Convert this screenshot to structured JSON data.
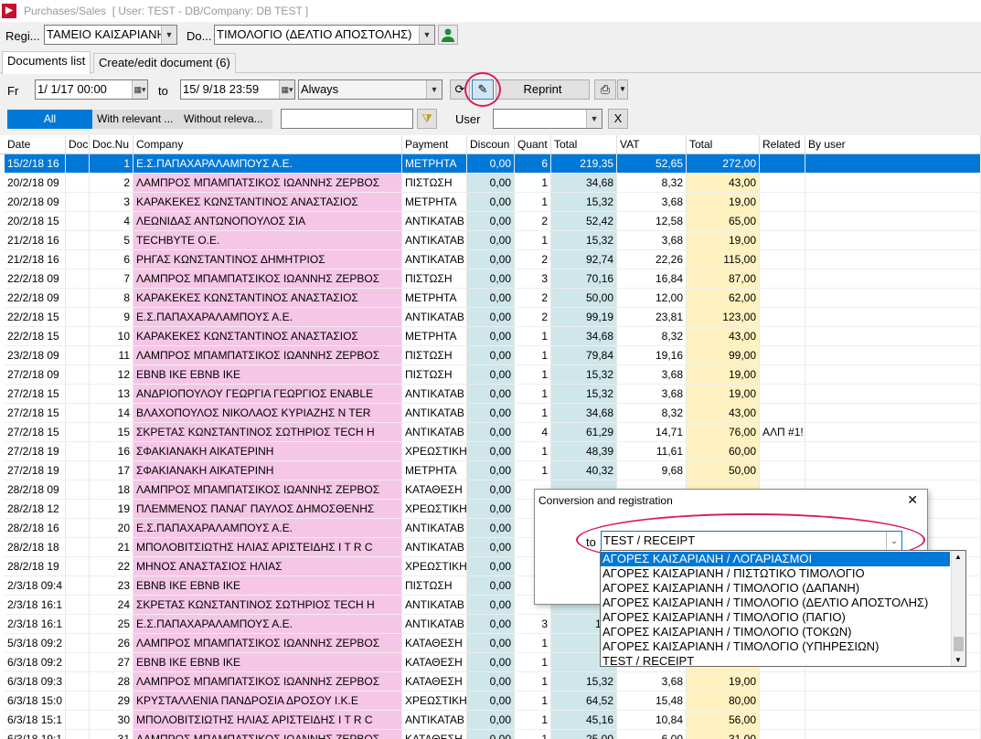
{
  "window": {
    "title": "Purchases/Sales",
    "context": "[ User: TEST - DB/Company: DB TEST ]"
  },
  "filters": {
    "register_label": "Regi...",
    "register_value": "ΤΑΜΕΙΟ ΚΑΙΣΑΡΙΑΝΗ",
    "doc_label": "Do...",
    "doc_value": "ΤΙΜΟΛΟΓΙΟ (ΔΕΛΤΙΟ ΑΠΟΣΤΟΛΗΣ)",
    "from_label": "Fr",
    "from_value": "1/ 1/17 00:00",
    "to_label": "to",
    "to_value": "15/ 9/18 23:59",
    "period_value": "Always",
    "reprint_label": "Reprint",
    "seg_all": "All",
    "seg_relevant": "With relevant ...",
    "seg_without": "Without releva...",
    "user_label": "User",
    "user_value": "",
    "search_value": "",
    "clear_label": "X"
  },
  "tabs": [
    {
      "label": "Documents list"
    },
    {
      "label": "Create/edit document (6)"
    }
  ],
  "grid": {
    "columns": [
      "Date",
      "Doc",
      "Doc.Nu",
      "Company",
      "Payment",
      "Discoun",
      "Quant",
      "Total",
      "VAT",
      "Total",
      "Related",
      "By user"
    ],
    "rows": [
      {
        "date": "15/2/18 16",
        "num": "1",
        "company": "Ε.Σ.ΠΑΠΑΧΑΡΑΛΑΜΠΟΥΣ Α.Ε.",
        "payment": "ΜΕΤΡΗΤΑ",
        "disc": "0,00",
        "qty": "6",
        "total": "219,35",
        "vat": "52,65",
        "gross": "272,00",
        "related": ""
      },
      {
        "date": "20/2/18 09",
        "num": "2",
        "company": "ΛΑΜΠΡΟΣ ΜΠΑΜΠΑΤΣΙΚΟΣ ΙΩΑΝΝΗΣ ΖΕΡΒΟΣ",
        "payment": "ΠΙΣΤΩΣΗ",
        "disc": "0,00",
        "qty": "1",
        "total": "34,68",
        "vat": "8,32",
        "gross": "43,00",
        "related": ""
      },
      {
        "date": "20/2/18 09",
        "num": "3",
        "company": "ΚΑΡΑΚΕΚΕΣ ΚΩΝΣΤΑΝΤΙΝΟΣ ΑΝΑΣΤΑΣΙΟΣ",
        "payment": "ΜΕΤΡΗΤΑ",
        "disc": "0,00",
        "qty": "1",
        "total": "15,32",
        "vat": "3,68",
        "gross": "19,00",
        "related": ""
      },
      {
        "date": "20/2/18 15",
        "num": "4",
        "company": "ΛΕΩΝΙΔΑΣ ΑΝΤΩΝΟΠΟΥΛΟΣ ΣΙΑ",
        "payment": "ΑΝΤΙΚΑΤΑΒ",
        "disc": "0,00",
        "qty": "2",
        "total": "52,42",
        "vat": "12,58",
        "gross": "65,00",
        "related": ""
      },
      {
        "date": "21/2/18 16",
        "num": "5",
        "company": "TECHBYTE Ο.Ε.",
        "payment": "ΑΝΤΙΚΑΤΑΒ",
        "disc": "0,00",
        "qty": "1",
        "total": "15,32",
        "vat": "3,68",
        "gross": "19,00",
        "related": ""
      },
      {
        "date": "21/2/18 16",
        "num": "6",
        "company": "ΡΗΓΑΣ ΚΩΝΣΤΑΝΤΙΝΟΣ ΔΗΜΗΤΡΙΟΣ",
        "payment": "ΑΝΤΙΚΑΤΑΒ",
        "disc": "0,00",
        "qty": "2",
        "total": "92,74",
        "vat": "22,26",
        "gross": "115,00",
        "related": ""
      },
      {
        "date": "22/2/18 09",
        "num": "7",
        "company": "ΛΑΜΠΡΟΣ ΜΠΑΜΠΑΤΣΙΚΟΣ ΙΩΑΝΝΗΣ ΖΕΡΒΟΣ",
        "payment": "ΠΙΣΤΩΣΗ",
        "disc": "0,00",
        "qty": "3",
        "total": "70,16",
        "vat": "16,84",
        "gross": "87,00",
        "related": ""
      },
      {
        "date": "22/2/18 09",
        "num": "8",
        "company": "ΚΑΡΑΚΕΚΕΣ ΚΩΝΣΤΑΝΤΙΝΟΣ ΑΝΑΣΤΑΣΙΟΣ",
        "payment": "ΜΕΤΡΗΤΑ",
        "disc": "0,00",
        "qty": "2",
        "total": "50,00",
        "vat": "12,00",
        "gross": "62,00",
        "related": ""
      },
      {
        "date": "22/2/18 15",
        "num": "9",
        "company": "Ε.Σ.ΠΑΠΑΧΑΡΑΛΑΜΠΟΥΣ Α.Ε.",
        "payment": "ΑΝΤΙΚΑΤΑΒ",
        "disc": "0,00",
        "qty": "2",
        "total": "99,19",
        "vat": "23,81",
        "gross": "123,00",
        "related": ""
      },
      {
        "date": "22/2/18 15",
        "num": "10",
        "company": "ΚΑΡΑΚΕΚΕΣ ΚΩΝΣΤΑΝΤΙΝΟΣ ΑΝΑΣΤΑΣΙΟΣ",
        "payment": "ΜΕΤΡΗΤΑ",
        "disc": "0,00",
        "qty": "1",
        "total": "34,68",
        "vat": "8,32",
        "gross": "43,00",
        "related": ""
      },
      {
        "date": "23/2/18 09",
        "num": "11",
        "company": "ΛΑΜΠΡΟΣ ΜΠΑΜΠΑΤΣΙΚΟΣ ΙΩΑΝΝΗΣ ΖΕΡΒΟΣ",
        "payment": "ΠΙΣΤΩΣΗ",
        "disc": "0,00",
        "qty": "1",
        "total": "79,84",
        "vat": "19,16",
        "gross": "99,00",
        "related": ""
      },
      {
        "date": "27/2/18 09",
        "num": "12",
        "company": "ΕΒΝΒ ΙΚΕ   ΕΒΝΒ ΙΚΕ",
        "payment": "ΠΙΣΤΩΣΗ",
        "disc": "0,00",
        "qty": "1",
        "total": "15,32",
        "vat": "3,68",
        "gross": "19,00",
        "related": ""
      },
      {
        "date": "27/2/18 15",
        "num": "13",
        "company": "ΑΝΔΡΙΟΠΟΥΛΟΥ ΓΕΩΡΓΙΑ ΓΕΩΡΓΙΟΣ  ENABLE",
        "payment": "ΑΝΤΙΚΑΤΑΒ",
        "disc": "0,00",
        "qty": "1",
        "total": "15,32",
        "vat": "3,68",
        "gross": "19,00",
        "related": ""
      },
      {
        "date": "27/2/18 15",
        "num": "14",
        "company": "ΒΛΑΧΟΠΟΥΛΟΣ ΝΙΚΟΛΑΟΣ ΚΥΡΙΑΖΗΣ   N TER",
        "payment": "ΑΝΤΙΚΑΤΑΒ",
        "disc": "0,00",
        "qty": "1",
        "total": "34,68",
        "vat": "8,32",
        "gross": "43,00",
        "related": ""
      },
      {
        "date": "27/2/18 15",
        "num": "15",
        "company": "ΣΚΡΕΤΑΣ ΚΩΝΣΤΑΝΤΙΝΟΣ ΣΩΤΗΡΙΟΣ   TECH H",
        "payment": "ΑΝΤΙΚΑΤΑΒ",
        "disc": "0,00",
        "qty": "4",
        "total": "61,29",
        "vat": "14,71",
        "gross": "76,00",
        "related": "ΑΛΠ #1!"
      },
      {
        "date": "27/2/18 19",
        "num": "16",
        "company": "ΣΦΑΚΙΑΝΑΚΗ ΑΙΚΑΤΕΡΙΝΗ",
        "payment": "ΧΡΕΩΣΤΙΚΗ",
        "disc": "0,00",
        "qty": "1",
        "total": "48,39",
        "vat": "11,61",
        "gross": "60,00",
        "related": ""
      },
      {
        "date": "27/2/18 19",
        "num": "17",
        "company": "ΣΦΑΚΙΑΝΑΚΗ ΑΙΚΑΤΕΡΙΝΗ",
        "payment": "ΜΕΤΡΗΤΑ",
        "disc": "0,00",
        "qty": "1",
        "total": "40,32",
        "vat": "9,68",
        "gross": "50,00",
        "related": ""
      },
      {
        "date": "28/2/18 09",
        "num": "18",
        "company": "ΛΑΜΠΡΟΣ ΜΠΑΜΠΑΤΣΙΚΟΣ ΙΩΑΝΝΗΣ ΖΕΡΒΟΣ",
        "payment": "ΚΑΤΑΘΕΣΗ",
        "disc": "0,00",
        "qty": "",
        "total": "",
        "vat": "",
        "gross": "",
        "related": ""
      },
      {
        "date": "28/2/18 12",
        "num": "19",
        "company": "ΠΛΕΜΜΕΝΟΣ ΠΑΝΑΓ ΠΑΥΛΟΣ ΔΗΜΟΣΘΕΝΗΣ",
        "payment": "ΧΡΕΩΣΤΙΚΗ",
        "disc": "0,00",
        "qty": "",
        "total": "",
        "vat": "",
        "gross": "",
        "related": ""
      },
      {
        "date": "28/2/18 16",
        "num": "20",
        "company": "Ε.Σ.ΠΑΠΑΧΑΡΑΛΑΜΠΟΥΣ Α.Ε.",
        "payment": "ΑΝΤΙΚΑΤΑΒ",
        "disc": "0,00",
        "qty": "",
        "total": "",
        "vat": "",
        "gross": "",
        "related": ""
      },
      {
        "date": "28/2/18 18",
        "num": "21",
        "company": "ΜΠΟΛΟΒΙΤΣΙΩΤΗΣ ΗΛΙΑΣ ΑΡΙΣΤΕΙΔΗΣ   I T R C",
        "payment": "ΑΝΤΙΚΑΤΑΒ",
        "disc": "0,00",
        "qty": "",
        "total": "",
        "vat": "",
        "gross": "",
        "related": ""
      },
      {
        "date": "28/2/18 19",
        "num": "22",
        "company": "ΜΗΝΟΣ ΑΝΑΣΤΑΣΙΟΣ ΗΛΙΑΣ",
        "payment": "ΧΡΕΩΣΤΙΚΗ",
        "disc": "0,00",
        "qty": "",
        "total": "",
        "vat": "",
        "gross": "",
        "related": ""
      },
      {
        "date": "2/3/18 09:4",
        "num": "23",
        "company": "ΕΒΝΒ ΙΚΕ   ΕΒΝΒ ΙΚΕ",
        "payment": "ΠΙΣΤΩΣΗ",
        "disc": "0,00",
        "qty": "",
        "total": "",
        "vat": "",
        "gross": "",
        "related": ""
      },
      {
        "date": "2/3/18 16:1",
        "num": "24",
        "company": "ΣΚΡΕΤΑΣ ΚΩΝΣΤΑΝΤΙΝΟΣ ΣΩΤΗΡΙΟΣ   TECH H",
        "payment": "ΑΝΤΙΚΑΤΑΒ",
        "disc": "0,00",
        "qty": "",
        "total": "",
        "vat": "",
        "gross": "",
        "related": ""
      },
      {
        "date": "2/3/18 16:1",
        "num": "25",
        "company": "Ε.Σ.ΠΑΠΑΧΑΡΑΛΑΜΠΟΥΣ Α.Ε.",
        "payment": "ΑΝΤΙΚΑΤΑΒ",
        "disc": "0,00",
        "qty": "3",
        "total": "166",
        "vat": "",
        "gross": "",
        "related": ""
      },
      {
        "date": "5/3/18 09:2",
        "num": "26",
        "company": "ΛΑΜΠΡΟΣ ΜΠΑΜΠΑΤΣΙΚΟΣ ΙΩΑΝΝΗΣ ΖΕΡΒΟΣ",
        "payment": "ΚΑΤΑΘΕΣΗ",
        "disc": "0,00",
        "qty": "1",
        "total": "25",
        "vat": "",
        "gross": "",
        "related": ""
      },
      {
        "date": "6/3/18 09:2",
        "num": "27",
        "company": "ΕΒΝΒ ΙΚΕ   ΕΒΝΒ ΙΚΕ",
        "payment": "ΚΑΤΑΘΕΣΗ",
        "disc": "0,00",
        "qty": "1",
        "total": "15",
        "vat": "",
        "gross": "",
        "related": ""
      },
      {
        "date": "6/3/18 09:3",
        "num": "28",
        "company": "ΛΑΜΠΡΟΣ ΜΠΑΜΠΑΤΣΙΚΟΣ ΙΩΑΝΝΗΣ ΖΕΡΒΟΣ",
        "payment": "ΚΑΤΑΘΕΣΗ",
        "disc": "0,00",
        "qty": "1",
        "total": "15,32",
        "vat": "3,68",
        "gross": "19,00",
        "related": ""
      },
      {
        "date": "6/3/18 15:0",
        "num": "29",
        "company": "ΚΡΥΣΤΑΛΛΕΝΙΑ ΠΑΝΔΡΟΣΙΑ ΔΡΟΣΟΥ Ι.Κ.Ε",
        "payment": "ΧΡΕΩΣΤΙΚΗ",
        "disc": "0,00",
        "qty": "1",
        "total": "64,52",
        "vat": "15,48",
        "gross": "80,00",
        "related": ""
      },
      {
        "date": "6/3/18 15:1",
        "num": "30",
        "company": "ΜΠΟΛΟΒΙΤΣΙΩΤΗΣ ΗΛΙΑΣ ΑΡΙΣΤΕΙΔΗΣ   I T R C",
        "payment": "ΑΝΤΙΚΑΤΑΒ",
        "disc": "0,00",
        "qty": "1",
        "total": "45,16",
        "vat": "10,84",
        "gross": "56,00",
        "related": ""
      },
      {
        "date": "6/3/18 19:1",
        "num": "31",
        "company": "ΛΑΜΠΡΟΣ ΜΠΑΜΠΑΤΣΙΚΟΣ ΙΩΑΝΝΗΣ ΖΕΡΒΟΣ",
        "payment": "ΚΑΤΑΘΕΣΗ",
        "disc": "0,00",
        "qty": "1",
        "total": "25,00",
        "vat": "6,00",
        "gross": "31,00",
        "related": ""
      }
    ]
  },
  "dialog": {
    "title": "Conversion and registration",
    "close": "✕",
    "to_label": "to",
    "selected": "TEST / RECEIPT",
    "options": [
      "ΑΓΟΡΕΣ ΚΑΙΣΑΡΙΑΝΗ / ΛΟΓΑΡΙΑΣΜΟΙ",
      "ΑΓΟΡΕΣ ΚΑΙΣΑΡΙΑΝΗ / ΠΙΣΤΩΤΙΚΟ ΤΙΜΟΛΟΓΙΟ",
      "ΑΓΟΡΕΣ ΚΑΙΣΑΡΙΑΝΗ / ΤΙΜΟΛΟΓΙΟ (ΔΑΠΑΝΗ)",
      "ΑΓΟΡΕΣ ΚΑΙΣΑΡΙΑΝΗ / ΤΙΜΟΛΟΓΙΟ (ΔΕΛΤΙΟ ΑΠΟΣΤΟΛΗΣ)",
      "ΑΓΟΡΕΣ ΚΑΙΣΑΡΙΑΝΗ / ΤΙΜΟΛΟΓΙΟ (ΠΑΓΙΟ)",
      "ΑΓΟΡΕΣ ΚΑΙΣΑΡΙΑΝΗ / ΤΙΜΟΛΟΓΙΟ (ΤΟΚΩΝ)",
      "ΑΓΟΡΕΣ ΚΑΙΣΑΡΙΑΝΗ / ΤΙΜΟΛΟΓΙΟ (ΥΠΗΡΕΣΙΩΝ)",
      "TEST / RECEIPT"
    ]
  },
  "colors": {
    "pink": "#f5c6e6",
    "teal": "#cfe6ea",
    "yellow": "#fff2c0",
    "selected": "#0078d7",
    "highlight": "#d81b60"
  }
}
